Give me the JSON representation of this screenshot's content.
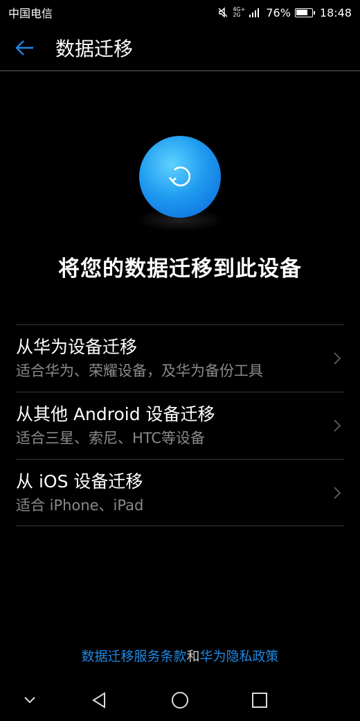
{
  "status_bar": {
    "carrier": "中国电信",
    "network_top": "4G+",
    "network_bottom": "2G",
    "battery_percent": "76%",
    "battery_level": 0.76,
    "time": "18:48"
  },
  "app_bar": {
    "title": "数据迁移",
    "back_icon": "arrow-left-icon"
  },
  "hero": {
    "icon": "refresh-icon",
    "headline": "将您的数据迁移到此设备"
  },
  "options": [
    {
      "title": "从华为设备迁移",
      "subtitle": "适合华为、荣耀设备，及华为备份工具"
    },
    {
      "title": "从其他 Android 设备迁移",
      "subtitle": "适合三星、索尼、HTC等设备"
    },
    {
      "title": "从 iOS 设备迁移",
      "subtitle": "适合 iPhone、iPad"
    }
  ],
  "footer": {
    "terms_link": "数据迁移服务条款",
    "conjunction": "和",
    "privacy_link": "华为隐私政策"
  },
  "colors": {
    "accent": "#1e88e5",
    "background": "#000000",
    "secondary_text": "#8a8a8a"
  }
}
